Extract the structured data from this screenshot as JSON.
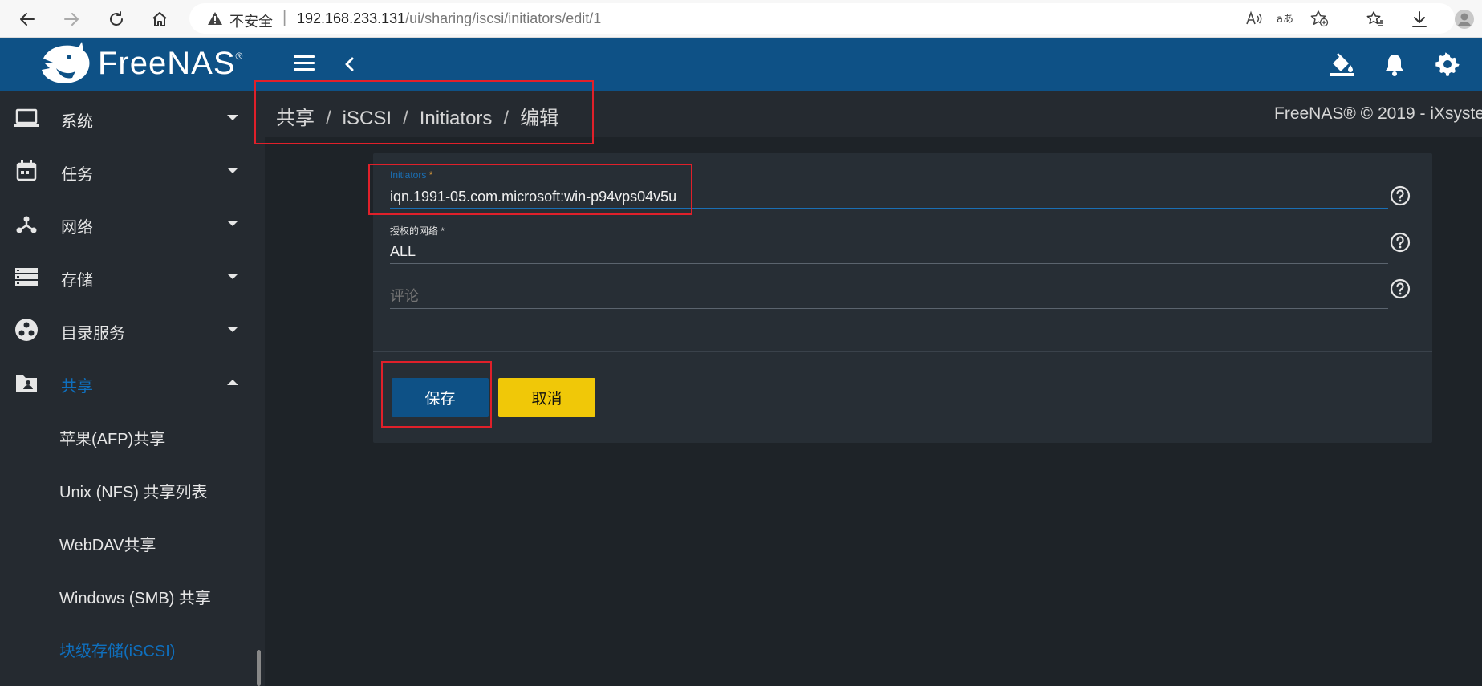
{
  "browser": {
    "insecure_label": "不安全",
    "separator": "|",
    "url_host": "192.168.233.131",
    "url_path": "/ui/sharing/iscsi/initiators/edit/1"
  },
  "header": {
    "brand": "FreeNAS",
    "brand_mark": "®"
  },
  "sidebar": {
    "items": [
      {
        "label": "系统",
        "icon": "laptop-icon"
      },
      {
        "label": "任务",
        "icon": "calendar-icon"
      },
      {
        "label": "网络",
        "icon": "network-icon"
      },
      {
        "label": "存储",
        "icon": "storage-icon"
      },
      {
        "label": "目录服务",
        "icon": "directory-icon"
      },
      {
        "label": "共享",
        "icon": "share-folder-icon"
      }
    ],
    "sub_items": [
      {
        "label": "苹果(AFP)共享"
      },
      {
        "label": "Unix (NFS) 共享列表"
      },
      {
        "label": "WebDAV共享"
      },
      {
        "label": "Windows (SMB) 共享"
      },
      {
        "label": "块级存储(iSCSI)"
      }
    ]
  },
  "breadcrumb": {
    "items": [
      "共享",
      "iSCSI",
      "Initiators",
      "编辑"
    ],
    "separator": "/"
  },
  "copyright": "FreeNAS® © 2019 - iXsyste",
  "form": {
    "initiators": {
      "label": "Initiators",
      "required_mark": "*",
      "value": "iqn.1991-05.com.microsoft:win-p94vps04v5u"
    },
    "network": {
      "label": "授权的网络",
      "required_mark": "*",
      "value": "ALL"
    },
    "comment": {
      "placeholder": "评论",
      "value": ""
    },
    "save_label": "保存",
    "cancel_label": "取消"
  },
  "colors": {
    "header_bg": "#0e5186",
    "sidebar_bg": "#252a30",
    "content_bg": "#1e2328",
    "card_bg": "#272e35",
    "accent": "#0f6fbd",
    "cancel_button": "#f0c808",
    "annotation": "#e0202a"
  }
}
